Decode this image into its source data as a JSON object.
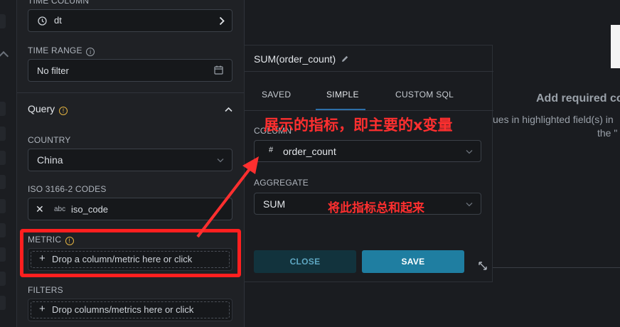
{
  "left_panel": {
    "time_column_label": "TIME COLUMN",
    "time_column_value": "dt",
    "time_range_label": "TIME RANGE",
    "time_range_value": "No filter",
    "query_title": "Query",
    "country_label": "COUNTRY",
    "country_value": "China",
    "iso_label": "ISO 3166-2 CODES",
    "iso_type": "abc",
    "iso_value": "iso_code",
    "metric_label": "METRIC",
    "metric_drop": "Drop a column/metric here or click",
    "filters_label": "FILTERS",
    "filters_drop": "Drop columns/metrics here or click"
  },
  "popover": {
    "title": "SUM(order_count)",
    "tabs": [
      "SAVED",
      "SIMPLE",
      "CUSTOM SQL"
    ],
    "active_tab": "SIMPLE",
    "column_label": "COLUMN",
    "column_type": "#",
    "column_value": "order_count",
    "aggregate_label": "AGGREGATE",
    "aggregate_value": "SUM",
    "close_label": "CLOSE",
    "save_label": "SAVE"
  },
  "right_panel": {
    "heading": "Add required co",
    "line1": "ues in highlighted field(s) in",
    "line2": "the \""
  },
  "annotations": {
    "metric_note": "展示的指标，即主要的x变量",
    "aggregate_note": "将此指标总和起来",
    "color": "#ff2f2f"
  },
  "colors": {
    "accent": "#1f7ea1",
    "close_bg": "#12333d",
    "close_text": "#5ea7c2",
    "warn": "#e3b341"
  }
}
